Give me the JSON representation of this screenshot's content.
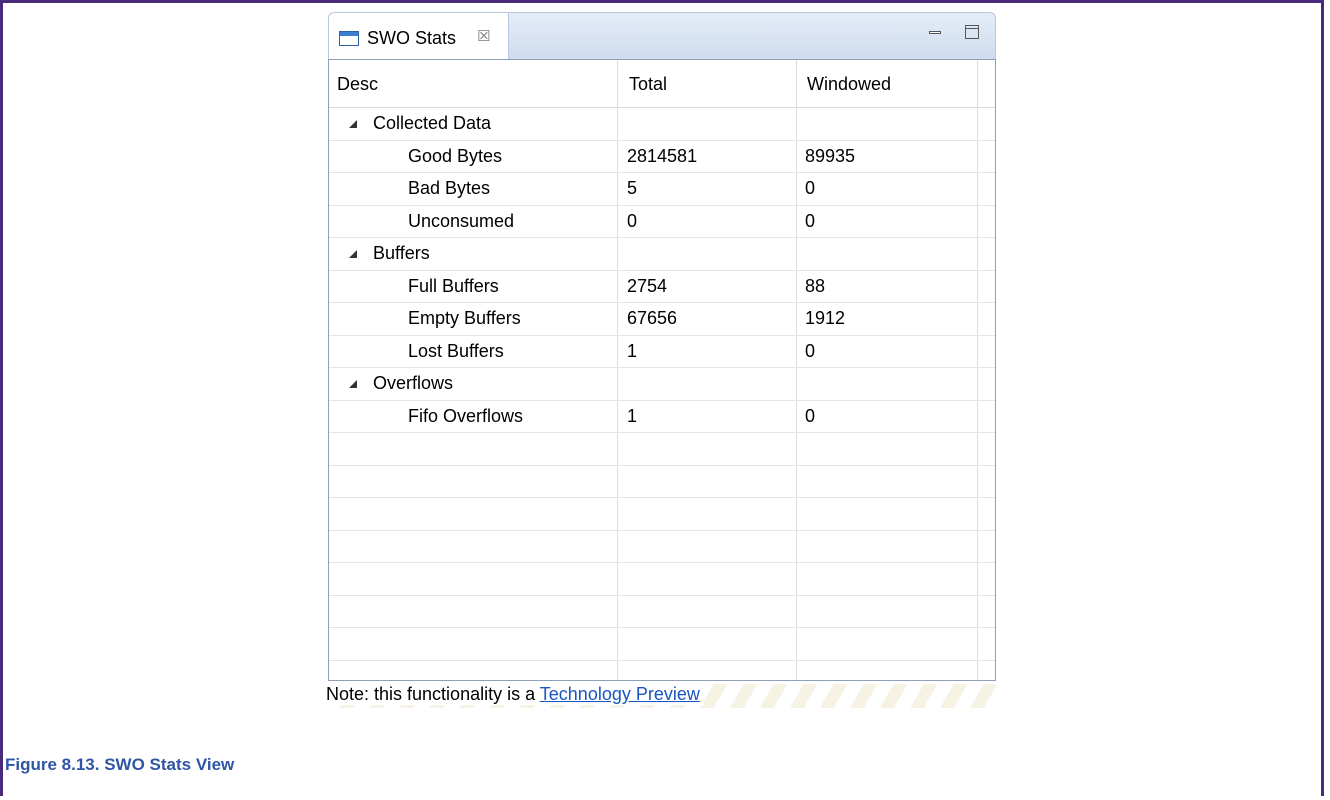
{
  "tab": {
    "title": "SWO Stats",
    "close_glyph": "☒"
  },
  "window_controls": {
    "minimize_icon": "minimize-icon",
    "maximize_icon": "maximize-icon"
  },
  "table": {
    "columns": [
      "Desc",
      "Total",
      "Windowed"
    ],
    "rows": [
      {
        "desc": "Collected Data",
        "total": "",
        "windowed": "",
        "group": true
      },
      {
        "desc": "Good Bytes",
        "total": "2814581",
        "windowed": "89935",
        "group": false
      },
      {
        "desc": "Bad Bytes",
        "total": "5",
        "windowed": "0",
        "group": false
      },
      {
        "desc": "Unconsumed",
        "total": "0",
        "windowed": "0",
        "group": false
      },
      {
        "desc": "Buffers",
        "total": "",
        "windowed": "",
        "group": true
      },
      {
        "desc": "Full Buffers",
        "total": "2754",
        "windowed": "88",
        "group": false
      },
      {
        "desc": "Empty Buffers",
        "total": "67656",
        "windowed": "1912",
        "group": false
      },
      {
        "desc": "Lost Buffers",
        "total": "1",
        "windowed": "0",
        "group": false
      },
      {
        "desc": "Overflows",
        "total": "",
        "windowed": "",
        "group": true
      },
      {
        "desc": "Fifo Overflows",
        "total": "1",
        "windowed": "0",
        "group": false
      }
    ]
  },
  "note": {
    "prefix": "Note: this functionality is a ",
    "link": "Technology Preview"
  },
  "caption": "Figure 8.13. SWO Stats View"
}
